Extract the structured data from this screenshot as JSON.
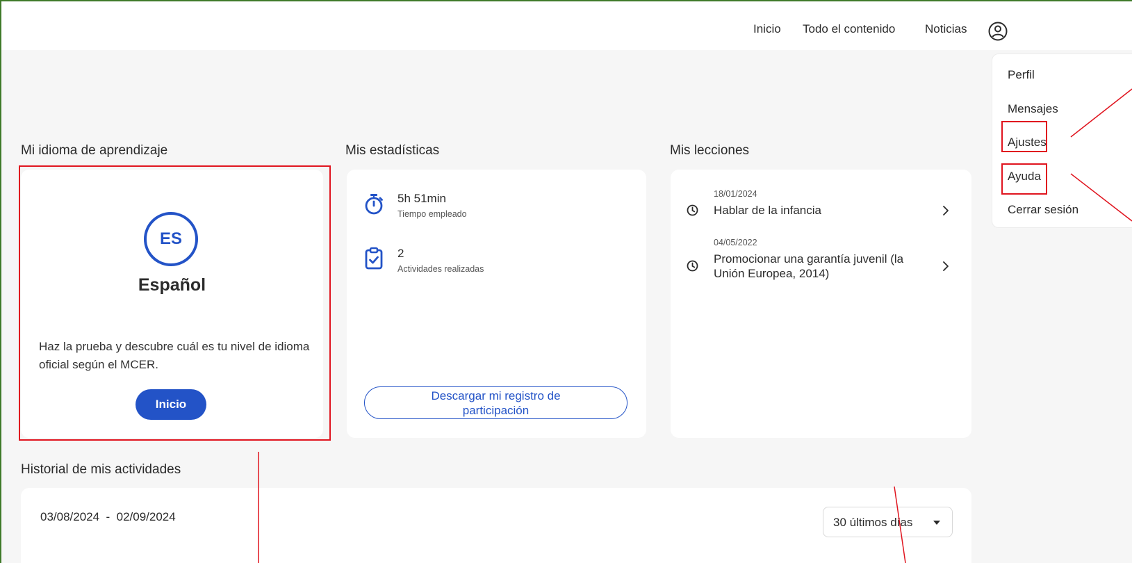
{
  "header": {
    "nav": [
      "Inicio",
      "Todo el contenido",
      "Noticias"
    ],
    "user_icon": "user-circle-icon"
  },
  "user_menu": {
    "items": [
      "Perfil",
      "Mensajes",
      "Ajustes",
      "Ayuda",
      "Cerrar sesión"
    ]
  },
  "language_card": {
    "section_title": "Mi idioma de aprendizaje",
    "badge": "ES",
    "name": "Español",
    "description": "Haz la prueba y descubre cuál es tu nivel de idioma oficial según el MCER.",
    "button_label": "Inicio"
  },
  "stats_card": {
    "section_title": "Mis estadísticas",
    "items": [
      {
        "value": "5h 51min",
        "label": "Tiempo empleado",
        "icon": "stopwatch-icon"
      },
      {
        "value": "2",
        "label": "Actividades realizadas",
        "icon": "clipboard-check-icon"
      }
    ],
    "download_label": "Descargar mi registro de participación"
  },
  "lessons_card": {
    "section_title": "Mis lecciones",
    "items": [
      {
        "date": "18/01/2024",
        "title": "Hablar de la infancia"
      },
      {
        "date": "04/05/2022",
        "title": "Promocionar una garantía juvenil (la Unión Europea, 2014)"
      }
    ]
  },
  "history": {
    "section_title": "Historial de mis actividades",
    "date_range": "03/08/2024  -  02/09/2024",
    "period_selected": "30 últimos días"
  },
  "colors": {
    "accent": "#2353c7",
    "annotation": "#e0151f",
    "frame": "#3f7a2a",
    "background": "#f6f6f6"
  }
}
